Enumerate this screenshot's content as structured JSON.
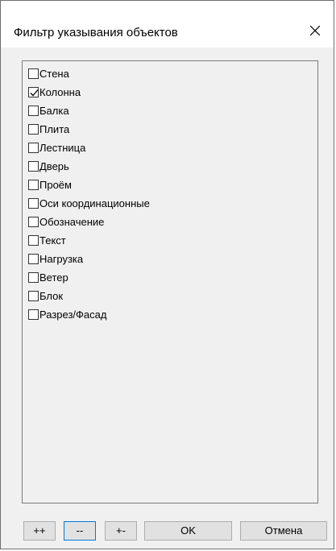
{
  "window": {
    "title": "Фильтр указывания объектов",
    "close_icon": "close-icon"
  },
  "list": {
    "items": [
      {
        "label": "Стена",
        "checked": false
      },
      {
        "label": "Колонна",
        "checked": true
      },
      {
        "label": "Балка",
        "checked": false
      },
      {
        "label": "Плита",
        "checked": false
      },
      {
        "label": "Лестница",
        "checked": false
      },
      {
        "label": "Дверь",
        "checked": false
      },
      {
        "label": "Проём",
        "checked": false
      },
      {
        "label": "Оси координационные",
        "checked": false
      },
      {
        "label": "Обозначение",
        "checked": false
      },
      {
        "label": "Текст",
        "checked": false
      },
      {
        "label": "Нагрузка",
        "checked": false
      },
      {
        "label": "Ветер",
        "checked": false
      },
      {
        "label": "Блок",
        "checked": false
      },
      {
        "label": "Разрез/Фасад",
        "checked": false
      }
    ]
  },
  "buttons": {
    "select_all": "++",
    "select_none": "--",
    "invert": "+-",
    "ok": "OK",
    "cancel": "Отмена"
  },
  "colors": {
    "focus_border": "#0078d7",
    "dialog_bg": "#f0f0f0",
    "titlebar_bg": "#ffffff"
  }
}
